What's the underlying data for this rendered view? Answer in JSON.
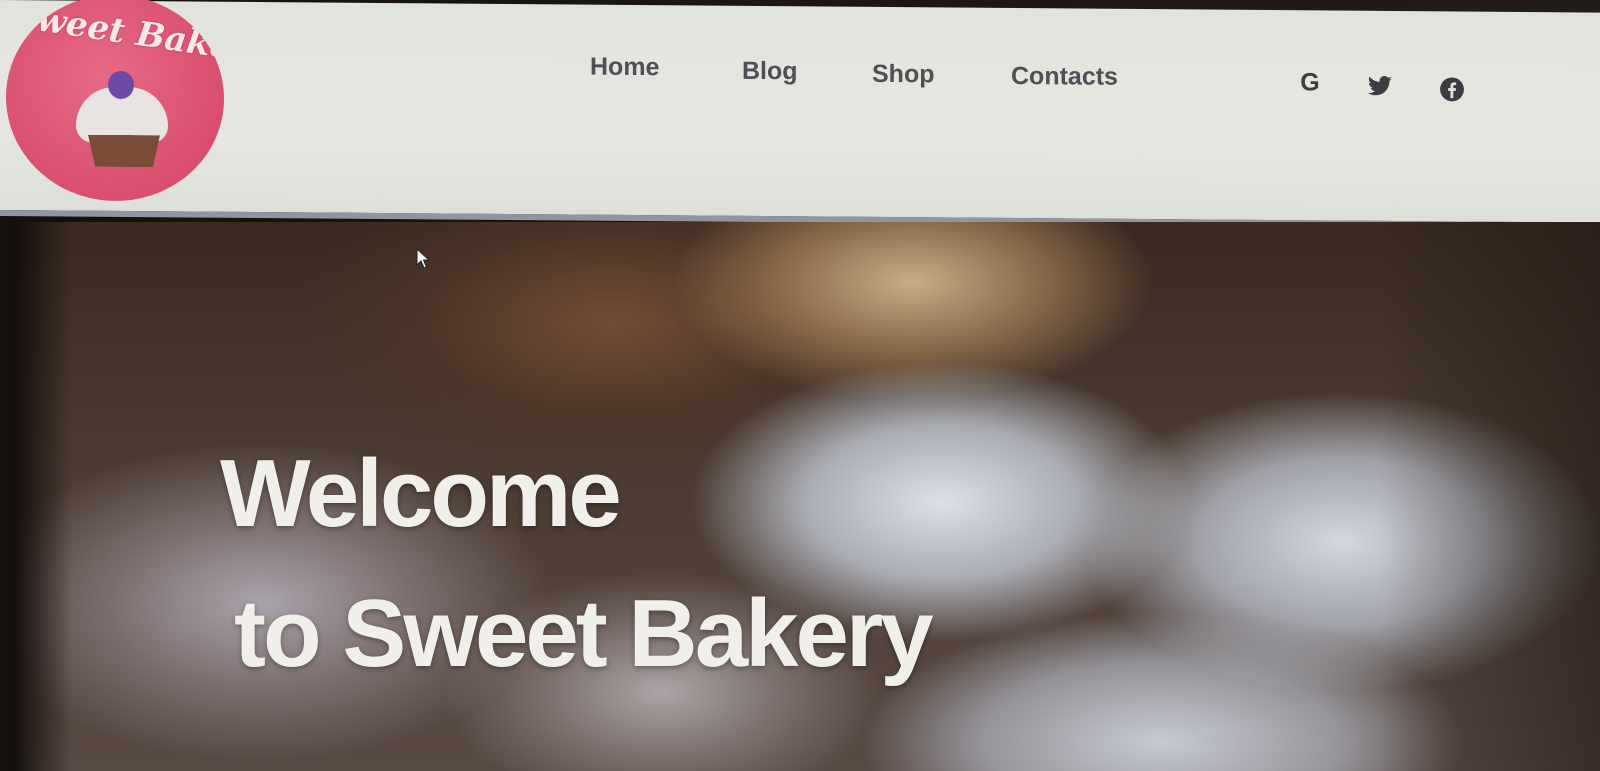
{
  "brand": {
    "logo_text": "Sweet Bakery"
  },
  "nav": {
    "items": [
      {
        "label": "Home"
      },
      {
        "label": "Blog"
      },
      {
        "label": "Shop"
      },
      {
        "label": "Contacts"
      }
    ]
  },
  "social": {
    "google_label": "G",
    "icons": [
      "google-icon",
      "twitter-icon",
      "facebook-icon"
    ]
  },
  "hero": {
    "title_line1": "Welcome",
    "title_line2": "to Sweet Bakery"
  },
  "colors": {
    "header_bg": "#e4e5df",
    "logo_pink": "#d94f6e",
    "nav_text": "#4e5055",
    "hero_text": "#f1efe9"
  }
}
